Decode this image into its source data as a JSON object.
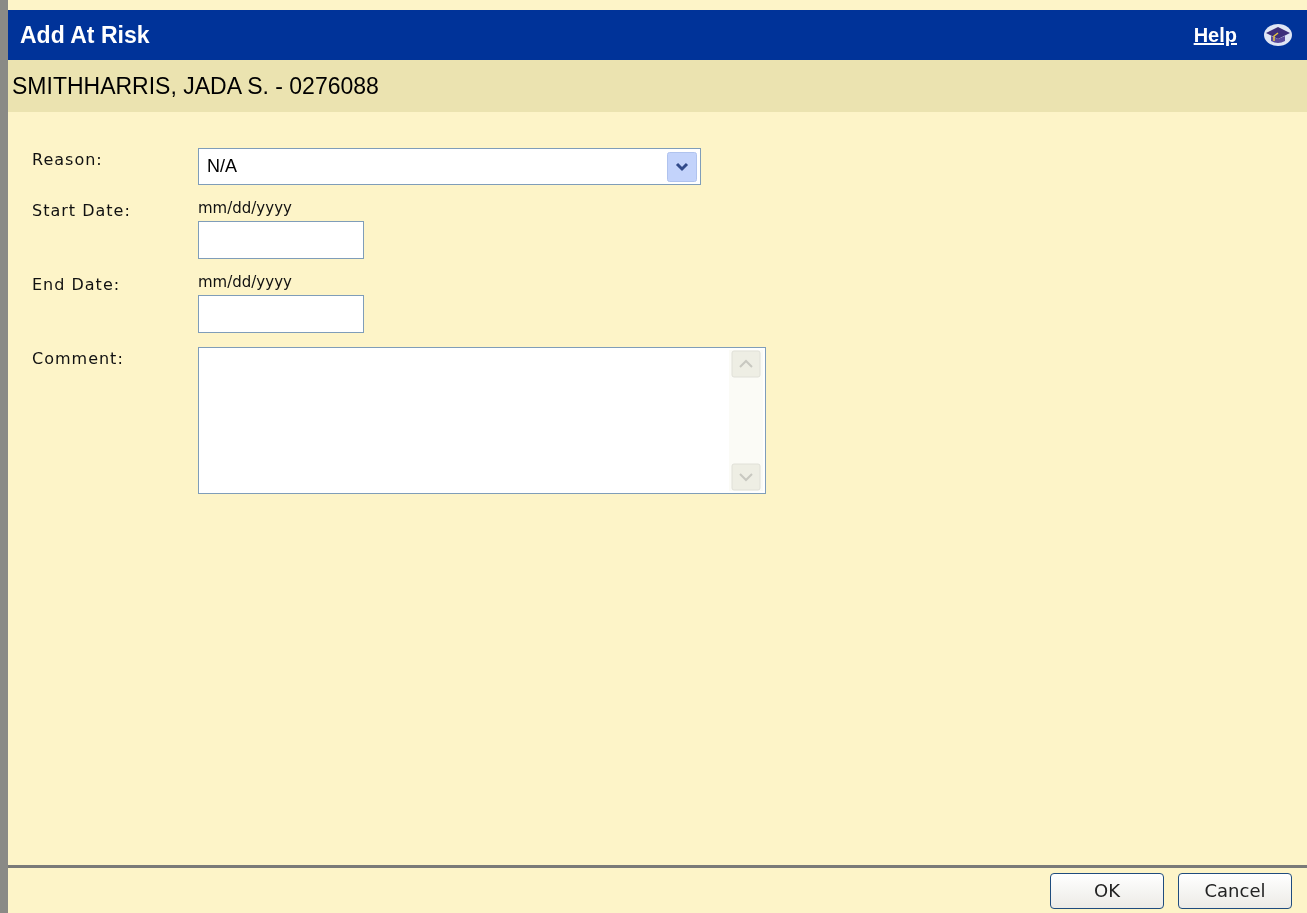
{
  "window": {
    "title": "Add At Risk",
    "help": "Help"
  },
  "student": {
    "name": "SMITHHARRIS, JADA S. - 0276088"
  },
  "fields": [
    {
      "kind": "select",
      "label": "Reason:",
      "value": "N/A"
    },
    {
      "kind": "date",
      "label": "Start Date:",
      "hint": "mm/dd/yyyy"
    },
    {
      "kind": "date",
      "label": "End Date:",
      "hint": "mm/dd/yyyy"
    },
    {
      "kind": "textarea",
      "label": "Comment:"
    }
  ],
  "buttons": [
    "OK",
    "Cancel"
  ]
}
